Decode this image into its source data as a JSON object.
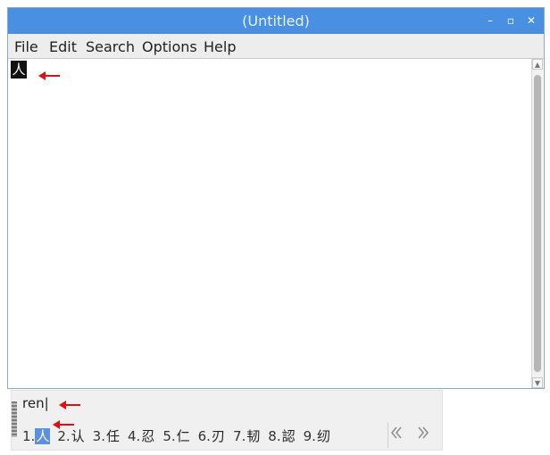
{
  "window": {
    "title": "(Untitled)",
    "controls": {
      "minimize": "–",
      "maximize": "▫",
      "close": "✕"
    }
  },
  "menubar": {
    "items": [
      {
        "label": "File"
      },
      {
        "label": "Edit"
      },
      {
        "label": "Search"
      },
      {
        "label": "Options"
      },
      {
        "label": "Help"
      }
    ]
  },
  "editor": {
    "text": "人"
  },
  "ime": {
    "preedit": "ren|",
    "candidates": [
      {
        "index": "1.",
        "char": "人"
      },
      {
        "index": "2.",
        "char": "认"
      },
      {
        "index": "3.",
        "char": "任"
      },
      {
        "index": "4.",
        "char": "忍"
      },
      {
        "index": "5.",
        "char": "仁"
      },
      {
        "index": "6.",
        "char": "刃"
      },
      {
        "index": "7.",
        "char": "韧"
      },
      {
        "index": "8.",
        "char": "認"
      },
      {
        "index": "9.",
        "char": "纫"
      }
    ],
    "selected_index": 0,
    "prev_icon": "double-chevron-left-icon",
    "next_icon": "double-chevron-right-icon"
  },
  "colors": {
    "titlebar": "#4a90e2",
    "selection": "#5b8fe0",
    "annotation_arrow": "#e01010"
  }
}
